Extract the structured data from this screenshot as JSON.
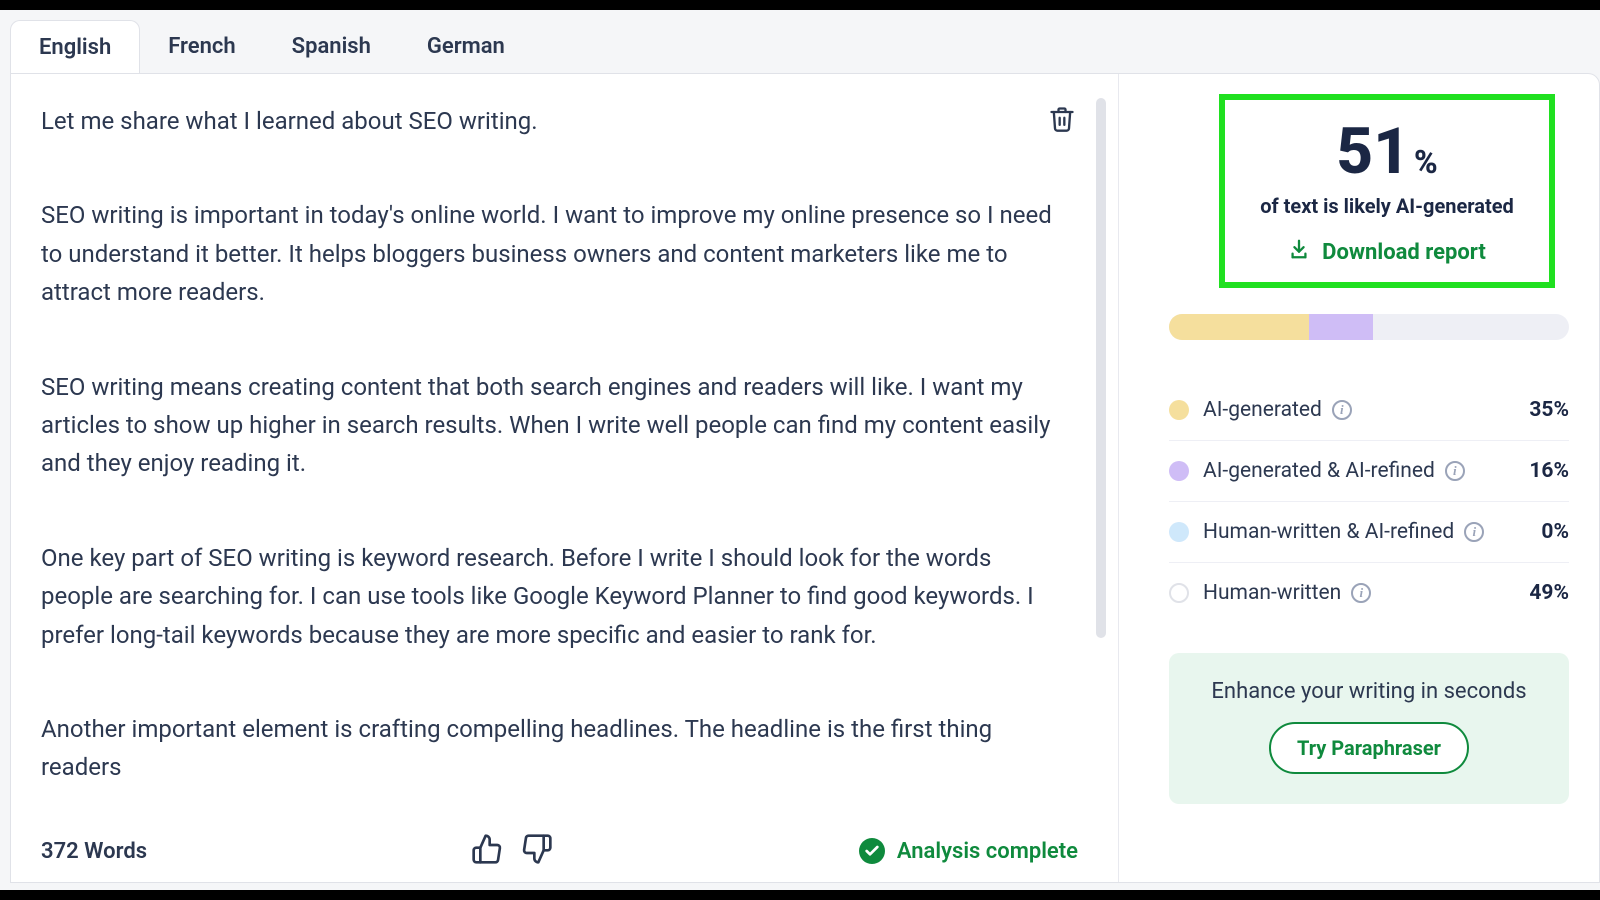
{
  "tabs": [
    "English",
    "French",
    "Spanish",
    "German"
  ],
  "active_tab_index": 0,
  "editor": {
    "paragraphs": [
      "Let me share what I learned about SEO writing.",
      "SEO writing is important in today's online world. I want to improve my online presence  so I need to understand it better. It helps bloggers  business owners  and content marketers like me to attract more readers.",
      "SEO writing means creating content that both search engines and readers will like. I want my articles to show up higher in search results. When I write well  people can find my content easily and they enjoy reading it.",
      "One key part of SEO writing is keyword research. Before I write  I should look for the words people are searching for. I can use tools like Google Keyword Planner to find good keywords. I prefer long-tail keywords because they are more specific and easier to rank for.",
      "Another important element is crafting compelling headlines. The headline is the first thing readers"
    ],
    "word_count_label": "372 Words",
    "status_label": "Analysis complete"
  },
  "score": {
    "value": "51",
    "unit": "%",
    "subtext": "of text is likely AI-generated",
    "download_label": "Download report"
  },
  "metrics": [
    {
      "label": "AI-generated",
      "pct": "35%"
    },
    {
      "label": "AI-generated & AI-refined",
      "pct": "16%"
    },
    {
      "label": "Human-written & AI-refined",
      "pct": "0%"
    },
    {
      "label": "Human-written",
      "pct": "49%"
    }
  ],
  "enhance": {
    "title": "Enhance your writing in seconds",
    "button": "Try Paraphraser"
  }
}
